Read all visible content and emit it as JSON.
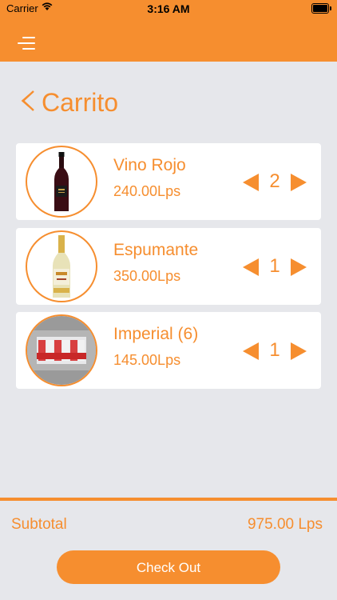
{
  "status_bar": {
    "carrier": "Carrier",
    "time": "3:16 AM"
  },
  "header": {
    "menu_icon": "hamburger-menu-icon"
  },
  "page": {
    "title": "Carrito",
    "back_icon": "chevron-left-icon"
  },
  "cart": {
    "items": [
      {
        "name": "Vino Rojo",
        "price": "240.00Lps",
        "quantity": "2",
        "image": "red-wine-bottle"
      },
      {
        "name": "Espumante",
        "price": "350.00Lps",
        "quantity": "1",
        "image": "sparkling-wine-bottle"
      },
      {
        "name": "Imperial (6)",
        "price": "145.00Lps",
        "quantity": "1",
        "image": "beer-six-pack"
      }
    ]
  },
  "footer": {
    "subtotal_label": "Subtotal",
    "subtotal_value": "975.00 Lps",
    "checkout_label": "Check Out"
  },
  "colors": {
    "accent": "#f68e2f",
    "background": "#e6e7eb",
    "card": "#ffffff"
  }
}
